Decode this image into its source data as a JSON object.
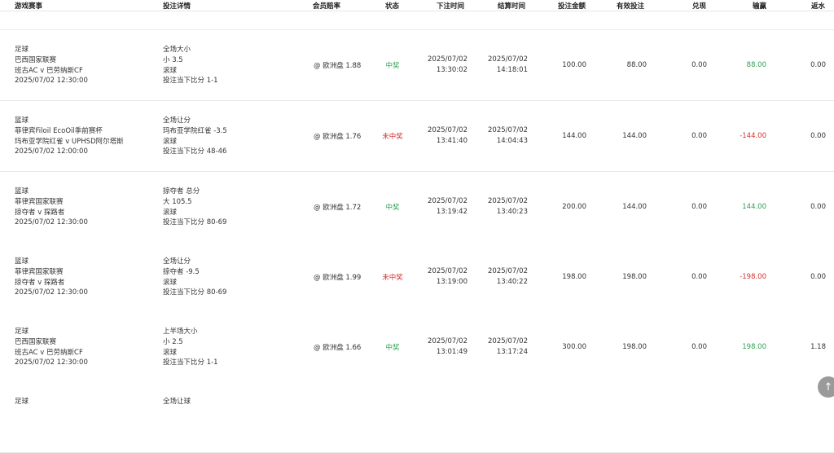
{
  "headers": [
    "游戏赛事",
    "投注详情",
    "会员赔率",
    "状态",
    "下注时间",
    "结算时间",
    "投注金额",
    "有效投注",
    "兑现",
    "输赢",
    "返水"
  ],
  "rows": [
    {
      "game": [
        "足球",
        "巴西国家联赛",
        "班古AC v 巴劳纳斯CF",
        "2025/07/02 12:30:00"
      ],
      "bet": [
        "全场大小",
        "小 3.5",
        "滚球",
        "投注当下比分 1-1"
      ],
      "odds": "@ 欧洲盘 1.88",
      "status": "中奖",
      "status_type": "win",
      "bet_date": "2025/07/02",
      "bet_time": "13:30:02",
      "settle_date": "2025/07/02",
      "settle_time": "14:18:01",
      "amount": "100.00",
      "valid": "88.00",
      "cashout": "0.00",
      "winloss": "88.00",
      "winloss_type": "pos",
      "rebate": "0.00"
    },
    {
      "game": [
        "篮球",
        "菲律宾Filoil EcoOil季前赛杯",
        "玛布亚学院红雀 v UPHSD阿尔塔斯",
        "2025/07/02 12:00:00"
      ],
      "bet": [
        "全场让分",
        "玛布亚学院红雀 -3.5",
        "滚球",
        "投注当下比分 48-46"
      ],
      "odds": "@ 欧洲盘 1.76",
      "status": "未中奖",
      "status_type": "lose",
      "bet_date": "2025/07/02",
      "bet_time": "13:41:40",
      "settle_date": "2025/07/02",
      "settle_time": "14:04:43",
      "amount": "144.00",
      "valid": "144.00",
      "cashout": "0.00",
      "winloss": "-144.00",
      "winloss_type": "neg",
      "rebate": "0.00"
    },
    {
      "game": [
        "篮球",
        "菲律宾国家联赛",
        "掠夺者 v 探路者",
        "2025/07/02 12:30:00"
      ],
      "bet": [
        "掠夺者 总分",
        "大 105.5",
        "滚球",
        "投注当下比分 80-69"
      ],
      "odds": "@ 欧洲盘 1.72",
      "status": "中奖",
      "status_type": "win",
      "bet_date": "2025/07/02",
      "bet_time": "13:19:42",
      "settle_date": "2025/07/02",
      "settle_time": "13:40:23",
      "amount": "200.00",
      "valid": "144.00",
      "cashout": "0.00",
      "winloss": "144.00",
      "winloss_type": "pos",
      "rebate": "0.00"
    },
    {
      "game": [
        "篮球",
        "菲律宾国家联赛",
        "掠夺者 v 探路者",
        "2025/07/02 12:30:00"
      ],
      "bet": [
        "全场让分",
        "掠夺者 -9.5",
        "滚球",
        "投注当下比分 80-69"
      ],
      "odds": "@ 欧洲盘 1.99",
      "status": "未中奖",
      "status_type": "lose",
      "bet_date": "2025/07/02",
      "bet_time": "13:19:00",
      "settle_date": "2025/07/02",
      "settle_time": "13:40:22",
      "amount": "198.00",
      "valid": "198.00",
      "cashout": "0.00",
      "winloss": "-198.00",
      "winloss_type": "neg",
      "rebate": "0.00"
    },
    {
      "game": [
        "足球",
        "巴西国家联赛",
        "班古AC v 巴劳纳斯CF",
        "2025/07/02 12:30:00"
      ],
      "bet": [
        "上半场大小",
        "小 2.5",
        "滚球",
        "投注当下比分 1-1"
      ],
      "odds": "@ 欧洲盘 1.66",
      "status": "中奖",
      "status_type": "win",
      "bet_date": "2025/07/02",
      "bet_time": "13:01:49",
      "settle_date": "2025/07/02",
      "settle_time": "13:17:24",
      "amount": "300.00",
      "valid": "198.00",
      "cashout": "0.00",
      "winloss": "198.00",
      "winloss_type": "pos",
      "rebate": "1.18"
    },
    {
      "game": [
        "足球"
      ],
      "bet": [
        "全场让球"
      ]
    }
  ],
  "scroll_top_icon": "arrow-up-icon",
  "scroll_top_glyph": "↑",
  "colors": {
    "win": "#2e9e4f",
    "lose": "#d0312d"
  }
}
